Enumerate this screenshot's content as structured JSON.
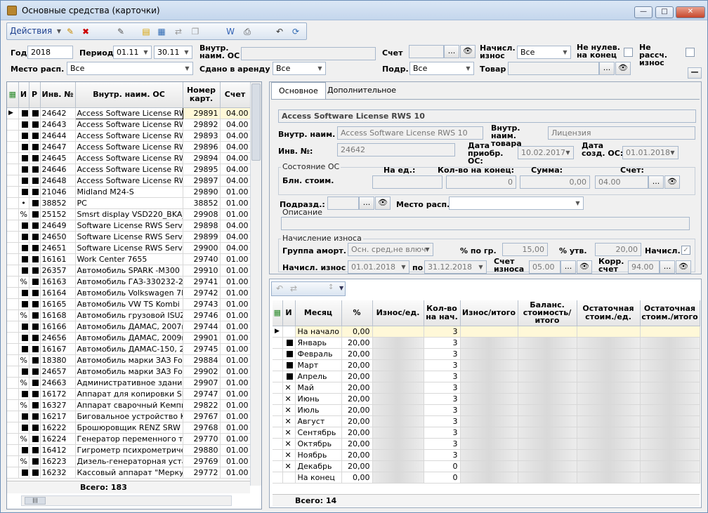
{
  "window": {
    "title": "Основные средства (карточки)",
    "min": "—",
    "max": "□",
    "close": "✕"
  },
  "toolbar": {
    "actions": "Действия"
  },
  "filters": {
    "year_label": "Год",
    "year": "2018",
    "period_label": "Период",
    "period_from": "01.11",
    "period_to": "30.11",
    "inner_label": "Внутр. наим. ОС",
    "inner": "",
    "account_label": "Счет",
    "account": "",
    "charged_label": "Начисл. износ",
    "charged": "Все",
    "nonzero_label": "Не нулев. на конец",
    "notcalc_label": "Не рассч. износ",
    "place_label": "Место расп.",
    "place": "Все",
    "rent_label": "Сдано в аренду",
    "rent": "Все",
    "dept_label": "Подр.",
    "dept": "Все",
    "goods_label": "Товар",
    "goods": ""
  },
  "list": {
    "cols": [
      "И",
      "Р",
      "Инв. №",
      "Внутр. наим. ОС",
      "Номер карт.",
      "Счет"
    ],
    "rows": [
      [
        "sq",
        "sq",
        "24642",
        "Access Software License RW",
        "29891",
        "04.00"
      ],
      [
        "sq",
        "sq",
        "24643",
        "Access Software License RW",
        "29892",
        "04.00"
      ],
      [
        "sq",
        "sq",
        "24644",
        "Access Software License RW",
        "29893",
        "04.00"
      ],
      [
        "sq",
        "sq",
        "24647",
        "Access Software License RW",
        "29896",
        "04.00"
      ],
      [
        "sq",
        "sq",
        "24645",
        "Access Software License RW",
        "29894",
        "04.00"
      ],
      [
        "sq",
        "sq",
        "24646",
        "Access Software License RW",
        "29895",
        "04.00"
      ],
      [
        "sq",
        "sq",
        "24648",
        "Access Software License RW",
        "29897",
        "04.00"
      ],
      [
        "sq",
        "sq",
        "21046",
        "Midland M24-S",
        "29890",
        "01.00"
      ],
      [
        "•",
        "sq",
        "38852",
        "PC",
        "38852",
        "01.00"
      ],
      [
        "%",
        "sq",
        "25152",
        "Smsrt display VSD220_BKA_",
        "29908",
        "01.00"
      ],
      [
        "sq",
        "sq",
        "24649",
        "Software License RWS Serve",
        "29898",
        "04.00"
      ],
      [
        "sq",
        "sq",
        "24650",
        "Software License RWS Serve",
        "29899",
        "04.00"
      ],
      [
        "sq",
        "sq",
        "24651",
        "Software License RWS Serve",
        "29900",
        "04.00"
      ],
      [
        "sq",
        "sq",
        "16161",
        "Work Center 7655",
        "29740",
        "01.00"
      ],
      [
        "sq",
        "sq",
        "26357",
        "Автомобиль  SPARK -M300",
        "29910",
        "01.00"
      ],
      [
        "%",
        "sq",
        "16163",
        "Автомобиль  ГАЗ-330232-28",
        "29741",
        "01.00"
      ],
      [
        "sq",
        "sq",
        "16164",
        "Автомобиль Volkswagen 7H",
        "29742",
        "01.00"
      ],
      [
        "sq",
        "sq",
        "16165",
        "Автомобиль VW TS Kombi 7",
        "29743",
        "01.00"
      ],
      [
        "%",
        "sq",
        "16168",
        "Автомобиль грузовой ISUZ",
        "29746",
        "01.00"
      ],
      [
        "sq",
        "sq",
        "16166",
        "Автомобиль ДАМАС, 2007г.",
        "29744",
        "01.00"
      ],
      [
        "sq",
        "sq",
        "24656",
        "Автомобиль ДАМАС, 2009г.",
        "29901",
        "01.00"
      ],
      [
        "sq",
        "sq",
        "16167",
        "Автомобиль ДАМАС-150, 20",
        "29745",
        "01.00"
      ],
      [
        "%",
        "sq",
        "18380",
        "Автомобиль марки ЗАЗ Forz",
        "29884",
        "01.00"
      ],
      [
        "sq",
        "sq",
        "24657",
        "Автомобиль марки ЗАЗ Forz",
        "29902",
        "01.00"
      ],
      [
        "%",
        "sq",
        "24663",
        "Административное здание:",
        "29907",
        "01.00"
      ],
      [
        "sq",
        "sq",
        "16172",
        "Аппарат для копировки SB",
        "29747",
        "01.00"
      ],
      [
        "%",
        "sq",
        "16327",
        "Аппарат сварочный Кемпи",
        "29822",
        "01.00"
      ],
      [
        "sq",
        "sq",
        "16217",
        "Биговальное устройство KL",
        "29767",
        "01.00"
      ],
      [
        "sq",
        "sq",
        "16222",
        "Брошюровщик RENZ SRW 3",
        "29768",
        "01.00"
      ],
      [
        "%",
        "sq",
        "16224",
        "Генератор переменного ток",
        "29770",
        "01.00"
      ],
      [
        "sq",
        "sq",
        "16412",
        "Гигрометр психрометричес",
        "29880",
        "01.00"
      ],
      [
        "%",
        "sq",
        "16223",
        "Дизель-генераторная устан",
        "29769",
        "01.00"
      ],
      [
        "sq",
        "sq",
        "16232",
        "Кассовый аппарат \"Меркур",
        "29772",
        "01.00"
      ]
    ],
    "total": "Всего: 183"
  },
  "card": {
    "tab_main": "Основное",
    "tab_extra": "Дополнительное",
    "name": "Access Software License RWS 10",
    "inner_label": "Внутр. наим.",
    "inner": "Access Software License RWS 10",
    "goods_label": "Внутр. наим. товара",
    "goods": "Лицензия",
    "inv_label": "Инв. №:",
    "inv": "24642",
    "acq_label": "Дата приобр. ОС:",
    "acq": "10.02.2017",
    "created_label": "Дата созд. ОС:",
    "created": "01.01.2018",
    "state_title": "Состояние ОС",
    "per_unit": "На ед.:",
    "qty_end": "Кол-во на конец:",
    "sum": "Сумма:",
    "acc": "Счет:",
    "book_label": "Блн. стоим.",
    "qty_val": "0",
    "sum_val": "0,00",
    "acc_val": "04.00",
    "dept_label": "Подразд.:",
    "place_label": "Место расп.",
    "desc_title": "Описание",
    "dep_title": "Начисление износа",
    "group_label": "Группа аморт.",
    "group": "Осн. сред,не влюч",
    "pct_gr_label": "% по гр.",
    "pct_gr": "15,00",
    "pct_ut_label": "% утв.",
    "pct_ut": "20,00",
    "charged_label": "Начисл.",
    "from_label": "Начисл. износ с",
    "from": "01.01.2018",
    "to_label": "по",
    "to": "31.12.2018",
    "dep_acc_label": "Счет износа",
    "dep_acc": "05.00",
    "corr_label": "Корр. счет",
    "corr": "94.00"
  },
  "months": {
    "cols": [
      "И",
      "Месяц",
      "%",
      "Износ/ед.",
      "Кол-во на нач.",
      "Износ/итого",
      "Баланс. стоимость/итого",
      "Остаточная стоим./ед.",
      "Остаточная стоим./итого"
    ],
    "rows": [
      [
        "",
        "На начало",
        "0,00",
        "3"
      ],
      [
        "sq",
        "Январь",
        "20,00",
        "3"
      ],
      [
        "sq",
        "Февраль",
        "20,00",
        "3"
      ],
      [
        "sq",
        "Март",
        "20,00",
        "3"
      ],
      [
        "sq",
        "Апрель",
        "20,00",
        "3"
      ],
      [
        "x",
        "Май",
        "20,00",
        "3"
      ],
      [
        "x",
        "Июнь",
        "20,00",
        "3"
      ],
      [
        "x",
        "Июль",
        "20,00",
        "3"
      ],
      [
        "x",
        "Август",
        "20,00",
        "3"
      ],
      [
        "x",
        "Сентябрь",
        "20,00",
        "3"
      ],
      [
        "x",
        "Октябрь",
        "20,00",
        "3"
      ],
      [
        "x",
        "Ноябрь",
        "20,00",
        "3"
      ],
      [
        "x",
        "Декабрь",
        "20,00",
        "0"
      ],
      [
        "",
        "На конец",
        "0,00",
        "0"
      ]
    ],
    "total": "Всего: 14"
  }
}
